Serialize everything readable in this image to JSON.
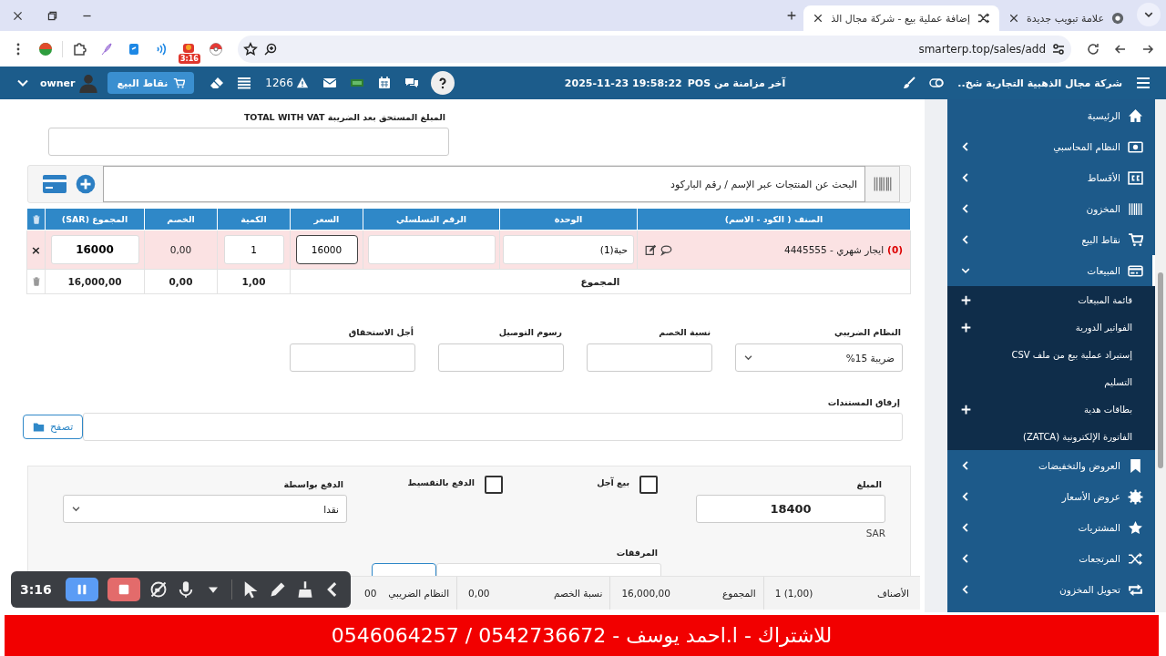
{
  "browser": {
    "tabs": [
      {
        "title": "علامة تبويب جديدة",
        "selected": false
      },
      {
        "title": "إضافة عملية بيع - شركة مجال الذ",
        "selected": true
      }
    ],
    "url": "smarterp.top/sales/add",
    "extension_badge": "3:16"
  },
  "header": {
    "company": "شركة مجال الذهبية التجارية شخ..",
    "sync_label": "آخر مزامنة من POS",
    "sync_time": "2025-11-23 19:58:22",
    "alerts": "1266",
    "pos_button": "نقاط البيع",
    "user": "owner"
  },
  "form": {
    "total_with_vat": {
      "label": "المبلغ المستحق بعد الضريبة TOTAL WITH VAT"
    },
    "search": {
      "placeholder": "البحث عن المنتجات عبر الإسم / رقم الباركود"
    },
    "table": {
      "columns": [
        "الصنف ( الكود - الاسم)",
        "الوحدة",
        "الرقم التسلسلي",
        "السعر",
        "الكمية",
        "الخصم",
        "المجموع (SAR)"
      ],
      "rows": [
        {
          "item": "ايجار شهري - 4445555",
          "stock": "(0)",
          "unit": "حبة(1)",
          "price": "16000",
          "quantity": "1",
          "discount": "0,00",
          "total": "16000",
          "remove": "×"
        }
      ],
      "footer": {
        "label": "المجموع",
        "quantity": "1,00",
        "discount": "0,00",
        "total": "16,000,00"
      }
    },
    "fields": [
      {
        "label": "النظام الضريبي",
        "kind": "select",
        "value": "ضريبة 15%"
      },
      {
        "label": "نسبة الخصم",
        "kind": "input"
      },
      {
        "label": "رسوم التوصيل",
        "kind": "input"
      },
      {
        "label": "أجل الاستحقاق",
        "kind": "input"
      }
    ],
    "attachments": {
      "label": "إرفاق المستندات",
      "button": "تصفح"
    },
    "payment": {
      "amount_label": "المبلغ",
      "amount": "18400",
      "currency": "SAR",
      "options": [
        {
          "label": "بيع آجل",
          "checked": false
        },
        {
          "label": "الدفع بالتقسيط",
          "checked": false
        }
      ],
      "method_label": "الدفع بواسطة",
      "method": "نقدا",
      "files_label": "المرفقات"
    }
  },
  "totals": [
    {
      "label": "الأصناف",
      "value": "1 (1,00)"
    },
    {
      "label": "المجموع",
      "value": "16,000,00"
    },
    {
      "label": "نسبة الخصم",
      "value": "0,00"
    },
    {
      "label": "النظام الضريبي",
      "value": "00"
    }
  ],
  "sidebar": {
    "items": [
      {
        "label": "الرئيسية",
        "kind": "link",
        "selected": false
      },
      {
        "label": "النظام المحاسبي",
        "kind": "menu",
        "expanded": false,
        "selected": false
      },
      {
        "label": "الأقساط",
        "kind": "menu",
        "expanded": false,
        "selected": false
      },
      {
        "label": "المخزون",
        "kind": "menu",
        "expanded": false,
        "selected": false
      },
      {
        "label": "نقاط البيع",
        "kind": "menu",
        "expanded": false,
        "selected": false
      },
      {
        "label": "المبيعات",
        "kind": "menu",
        "expanded": true,
        "selected": true,
        "children": [
          {
            "label": "قائمة المبيعات",
            "expandable": true
          },
          {
            "label": "الفواتير الدورية",
            "expandable": true
          },
          {
            "label": "إستيراد عملية بيع من ملف CSV",
            "expandable": false
          },
          {
            "label": "التسليم",
            "expandable": false
          },
          {
            "label": "بطاقات هدية",
            "expandable": true
          },
          {
            "label": "الفاتورة الإلكترونية (ZATCA)",
            "expandable": false
          }
        ]
      },
      {
        "label": "العروض والتخفيضات",
        "kind": "menu",
        "expanded": false,
        "selected": false
      },
      {
        "label": "عروض الأسعار",
        "kind": "menu",
        "expanded": false,
        "selected": false
      },
      {
        "label": "المشتريات",
        "kind": "menu",
        "expanded": false,
        "selected": false
      },
      {
        "label": "المرتجعات",
        "kind": "menu",
        "expanded": false,
        "selected": false
      },
      {
        "label": "تحويل المخزون",
        "kind": "menu",
        "expanded": false,
        "selected": false
      }
    ]
  },
  "recorder": {
    "time": "3:16"
  },
  "banner": {
    "text": "للاشتراك - ا.احمد يوسف - 0542736672 / 0546064257"
  }
}
